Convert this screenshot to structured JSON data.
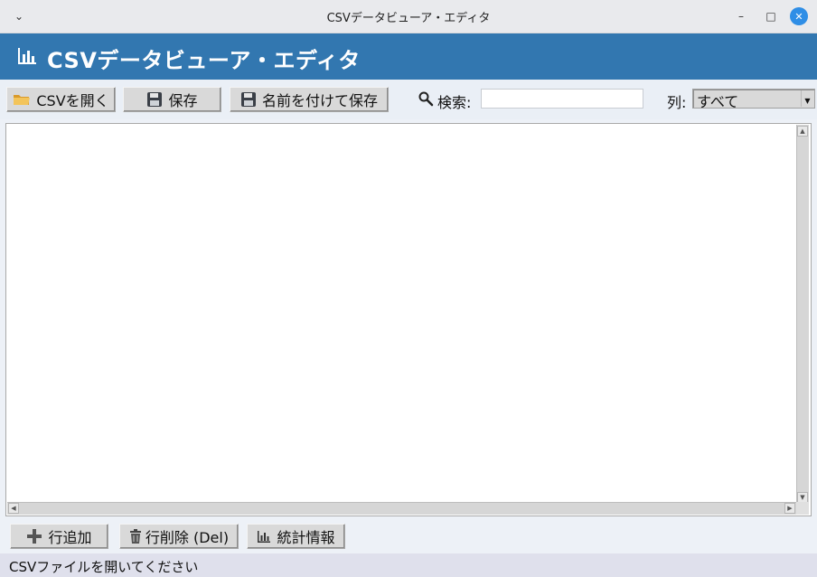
{
  "window": {
    "title": "CSVデータビューア・エディタ",
    "menu_glyph": "⌄",
    "minimize_glyph": "–",
    "maximize_glyph": "□",
    "close_glyph": "✕"
  },
  "header": {
    "title": "CSVデータビューア・エディタ",
    "icon": "bar-chart-icon",
    "background": "#3277b0"
  },
  "toolbar": {
    "open_label": "CSVを開く",
    "open_icon": "folder-icon",
    "save_label": "保存",
    "save_icon": "floppy-disk-icon",
    "save_as_label": "名前を付けて保存",
    "save_as_icon": "floppy-disk-icon",
    "search_label": "検索:",
    "search_icon": "magnifier-icon",
    "search_value": "",
    "column_label": "列:",
    "column_selected": "すべて"
  },
  "table": {
    "rows": []
  },
  "bottom_bar": {
    "add_row_label": "行追加",
    "add_row_icon": "plus-icon",
    "delete_row_label": "行削除 (Del)",
    "delete_row_icon": "trash-icon",
    "stats_label": "統計情報",
    "stats_icon": "bar-chart-icon"
  },
  "status": {
    "text": "CSVファイルを開いてください"
  }
}
